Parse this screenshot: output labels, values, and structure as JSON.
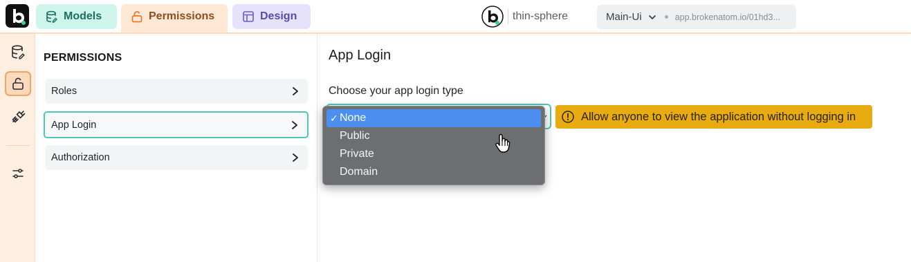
{
  "topbar": {
    "tabs": [
      {
        "label": "Models",
        "icon": "database-icon"
      },
      {
        "label": "Permissions",
        "icon": "unlock-icon"
      },
      {
        "label": "Design",
        "icon": "layout-icon"
      }
    ],
    "workspace_name": "thin-sphere",
    "app_selector": {
      "name": "Main-Ui",
      "url": "app.brokenatom.io/01hd3..."
    }
  },
  "rail": {
    "items": [
      {
        "icon": "database-icon",
        "active": false
      },
      {
        "icon": "unlock-icon",
        "active": true
      },
      {
        "icon": "plug-icon",
        "active": false
      },
      {
        "icon": "sliders-icon",
        "active": false
      }
    ]
  },
  "sidebar": {
    "title": "PERMISSIONS",
    "items": [
      {
        "label": "Roles"
      },
      {
        "label": "App Login",
        "selected": true
      },
      {
        "label": "Authorization"
      }
    ]
  },
  "main": {
    "title": "App Login",
    "login_type_label": "Choose your app login type",
    "hint": "Allow anyone to view the application without logging in",
    "dropdown": {
      "selected": "None",
      "check_mark": "✓",
      "options": [
        "None",
        "Public",
        "Private",
        "Domain"
      ]
    }
  },
  "colors": {
    "accent_teal": "#4cc8b6",
    "permissions_orange": "#f0a46a",
    "hint_yellow": "#e9ac10",
    "dropdown_highlight": "#4c8ff0"
  }
}
